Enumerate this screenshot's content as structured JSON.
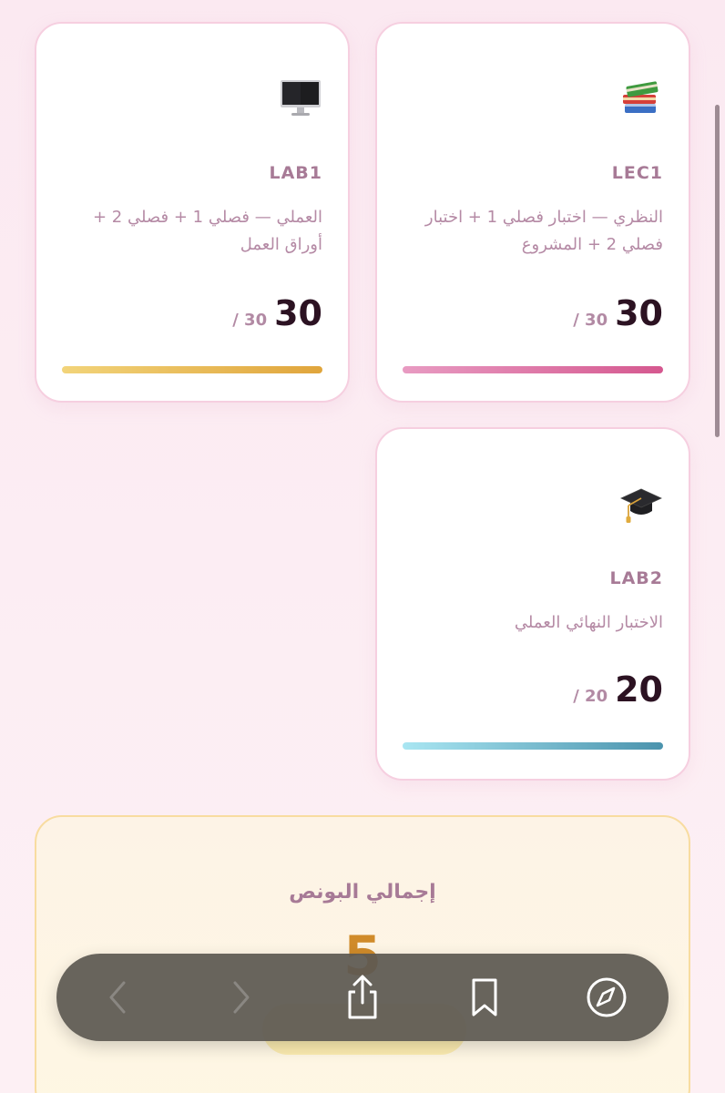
{
  "cards": [
    {
      "id": "lec1",
      "icon": "books-icon",
      "code": "LEC1",
      "description": "النظري — اختبار فصلي 1 + اختبار فصلي 2 + المشروع",
      "score": "30",
      "max": "/ 30",
      "progress": 1.0,
      "bar_colors": [
        "#e89bc2",
        "#d5588f"
      ]
    },
    {
      "id": "lab1",
      "icon": "desktop-computer-icon",
      "code": "LAB1",
      "description": "العملي — فصلي 1 + فصلي 2 + أوراق العمل",
      "score": "30",
      "max": "/ 30",
      "progress": 1.0,
      "bar_colors": [
        "#f2d47a",
        "#e0a53c"
      ]
    },
    {
      "id": "lab2",
      "icon": "graduation-cap-icon",
      "code": "LAB2",
      "description": "الاختبار النهائي العملي",
      "score": "20",
      "max": "/ 20",
      "progress": 1.0,
      "bar_colors": [
        "#a9e6f2",
        "#4b93ad"
      ]
    }
  ],
  "bonus": {
    "title": "إجمالي البونص",
    "total": "5"
  },
  "toolbar": {
    "items": [
      "back-icon",
      "forward-icon",
      "share-icon",
      "bookmarks-icon",
      "safari-compass-icon"
    ]
  }
}
